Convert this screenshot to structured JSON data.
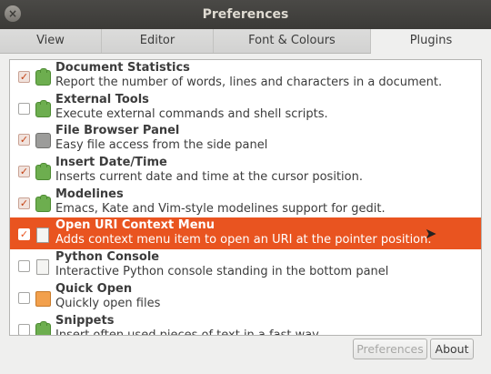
{
  "window": {
    "title": "Preferences",
    "close_glyph": "×"
  },
  "tabs": [
    {
      "label": "View"
    },
    {
      "label": "Editor"
    },
    {
      "label": "Font & Colours"
    },
    {
      "label": "Plugins",
      "active": true
    }
  ],
  "plugins": [
    {
      "name": "Document Statistics",
      "desc": "Report the number of words, lines and characters in a document.",
      "enabled": true,
      "icon": "puzzle-icon"
    },
    {
      "name": "External Tools",
      "desc": "Execute external commands and shell scripts.",
      "enabled": false,
      "icon": "puzzle-icon"
    },
    {
      "name": "File Browser Panel",
      "desc": "Easy file access from the side panel",
      "enabled": true,
      "icon": "file-manager-icon"
    },
    {
      "name": "Insert Date/Time",
      "desc": "Inserts current date and time at the cursor position.",
      "enabled": true,
      "icon": "puzzle-icon"
    },
    {
      "name": "Modelines",
      "desc": "Emacs, Kate and Vim-style modelines support for gedit.",
      "enabled": true,
      "icon": "puzzle-icon"
    },
    {
      "name": "Open URI Context Menu",
      "desc": "Adds context menu item to open an URI at the pointer position.",
      "enabled": true,
      "selected": true,
      "icon": "document-icon"
    },
    {
      "name": "Python Console",
      "desc": "Interactive Python console standing in the bottom panel",
      "enabled": false,
      "icon": "document-icon"
    },
    {
      "name": "Quick Open",
      "desc": "Quickly open files",
      "enabled": false,
      "icon": "folder-icon"
    },
    {
      "name": "Snippets",
      "desc": "Insert often used pieces of text in a fast way",
      "enabled": false,
      "icon": "puzzle-icon"
    }
  ],
  "buttons": {
    "preferences": "Preferences",
    "about": "About"
  },
  "check_glyph": "✓",
  "colors": {
    "selection": "#e95420",
    "titlebar": "#3b3a37"
  }
}
